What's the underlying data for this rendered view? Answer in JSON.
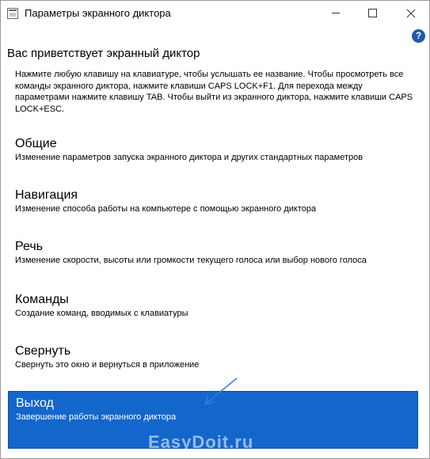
{
  "window": {
    "title": "Параметры экранного диктора",
    "icon": "narrator-app-icon",
    "controls": {
      "minimize_icon": "minimize-icon",
      "maximize_icon": "maximize-icon",
      "close_icon": "close-icon"
    }
  },
  "help": {
    "icon": "help-icon",
    "glyph": "?"
  },
  "welcome": {
    "title": "Вас приветствует экранный диктор",
    "intro": "Нажмите любую клавишу на клавиатуре, чтобы услышать ее название. Чтобы просмотреть все команды экранного диктора, нажмите клавиши CAPS LOCK+F1. Для перехода между параметрами нажмите клавишу TAB. Чтобы выйти из экранного диктора, нажмите клавиши CAPS LOCK+ESC."
  },
  "menu": {
    "items": [
      {
        "title": "Общие",
        "description": "Изменение параметров запуска экранного диктора и других стандартных параметров"
      },
      {
        "title": "Навигация",
        "description": "Изменение способа работы на компьютере с помощью экранного диктора"
      },
      {
        "title": "Речь",
        "description": "Изменение скорости, высоты или громкости текущего голоса или выбор нового голоса"
      },
      {
        "title": "Команды",
        "description": "Создание команд, вводимых с клавиатуры"
      },
      {
        "title": "Свернуть",
        "description": "Свернуть это окно и вернуться в приложение"
      },
      {
        "title": "Выход",
        "description": "Завершение работы экранного диктора",
        "selected": true
      }
    ]
  },
  "colors": {
    "selected_bg": "#1366cb",
    "help_icon": "#1e5aa8",
    "arrow": "#2f7fd6"
  },
  "watermark": "EasyDoit.ru"
}
